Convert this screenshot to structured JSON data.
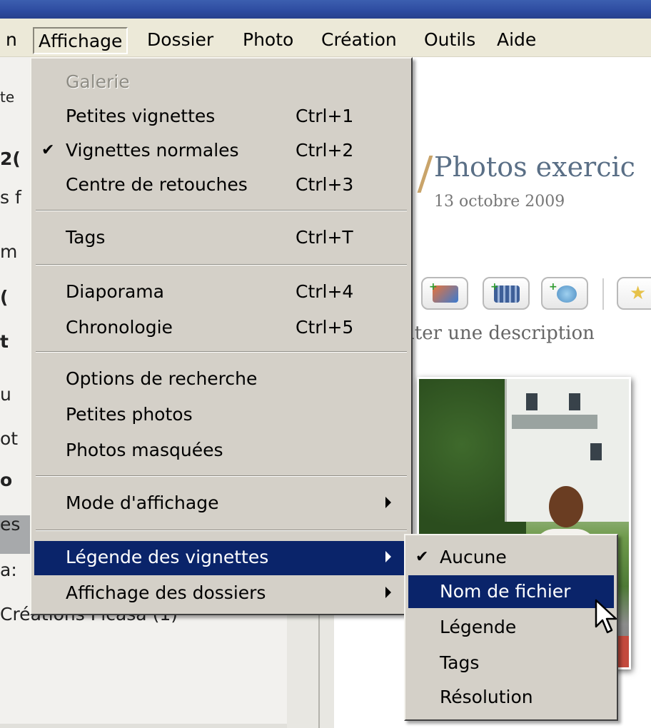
{
  "menubar": {
    "items": [
      {
        "label": "Affichage",
        "active": true
      },
      {
        "label": "Dossier"
      },
      {
        "label": "Photo"
      },
      {
        "label": "Création"
      },
      {
        "label": "Outils"
      },
      {
        "label": "Aide"
      }
    ],
    "left_fragment": "n"
  },
  "left_panel": {
    "fragments": [
      "te",
      "2(",
      "s f",
      "m",
      "(",
      "t",
      "u",
      "ot",
      "o",
      "es",
      "a:",
      "Créations Picasa (1)"
    ]
  },
  "album": {
    "title": "Photos exercic",
    "date": "13 octobre 2009",
    "add_description": "uter une description"
  },
  "menu": {
    "items": [
      {
        "label": "Galerie",
        "disabled": true
      },
      {
        "label": "Petites vignettes",
        "shortcut": "Ctrl+1"
      },
      {
        "label": "Vignettes normales",
        "shortcut": "Ctrl+2",
        "checked": true
      },
      {
        "label": "Centre de retouches",
        "shortcut": "Ctrl+3"
      },
      {
        "label": "Tags",
        "shortcut": "Ctrl+T"
      },
      {
        "label": "Diaporama",
        "shortcut": "Ctrl+4"
      },
      {
        "label": "Chronologie",
        "shortcut": "Ctrl+5"
      },
      {
        "label": "Options de recherche"
      },
      {
        "label": "Petites photos"
      },
      {
        "label": "Photos masquées"
      },
      {
        "label": "Mode d'affichage",
        "submenu": true
      },
      {
        "label": "Légende des vignettes",
        "submenu": true,
        "highlighted": true
      },
      {
        "label": "Affichage des dossiers",
        "submenu": true
      }
    ],
    "check_glyph": "✔"
  },
  "submenu": {
    "items": [
      {
        "label": "Aucune",
        "checked": true
      },
      {
        "label": "Nom de fichier",
        "highlighted": true
      },
      {
        "label": "Légende"
      },
      {
        "label": "Tags"
      },
      {
        "label": "Résolution"
      }
    ]
  },
  "colors": {
    "menu_bg": "#d4d0c8",
    "highlight": "#0a246a",
    "titlebar": "#2d4ba0"
  },
  "icons": [
    "add-photo-icon",
    "add-movie-icon",
    "add-web-icon",
    "star-icon",
    "cursor-pointer-icon",
    "check-icon",
    "submenu-arrow-icon"
  ]
}
